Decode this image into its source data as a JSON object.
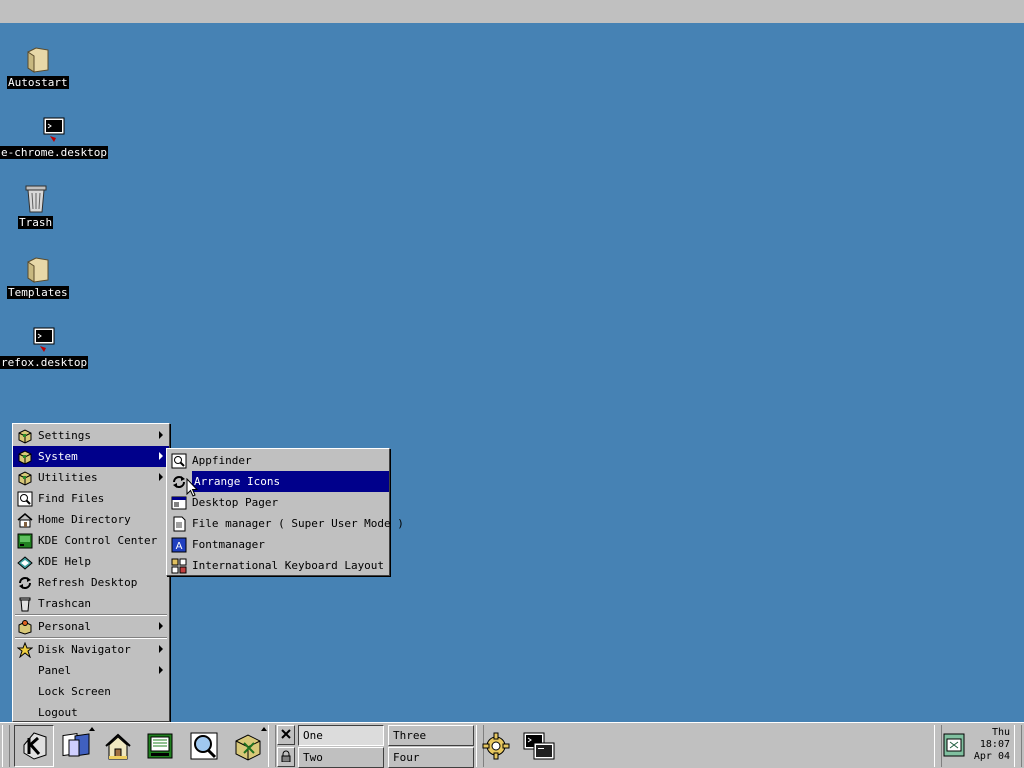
{
  "desktop": {
    "icons": [
      {
        "label": "Autostart",
        "icon": "folder-icon"
      },
      {
        "label": "e-chrome.desktop",
        "icon": "terminal-link-icon"
      },
      {
        "label": "Trash",
        "icon": "trash-icon"
      },
      {
        "label": "Templates",
        "icon": "folder-icon"
      },
      {
        "label": "refox.desktop",
        "icon": "terminal-link-icon"
      }
    ]
  },
  "kmenu": {
    "items": [
      {
        "label": "Settings",
        "icon": "package-icon",
        "submenu": true
      },
      {
        "label": "System",
        "icon": "package-icon",
        "submenu": true,
        "highlighted": true
      },
      {
        "label": "Utilities",
        "icon": "package-icon",
        "submenu": true
      },
      {
        "label": "Find Files",
        "icon": "find-icon"
      },
      {
        "label": "Home Directory",
        "icon": "home-icon"
      },
      {
        "label": "KDE Control Center",
        "icon": "control-center-icon"
      },
      {
        "label": "KDE Help",
        "icon": "help-icon"
      },
      {
        "label": "Refresh Desktop",
        "icon": "refresh-icon"
      },
      {
        "label": "Trashcan",
        "icon": "trash-icon"
      },
      {
        "label": "Personal",
        "icon": "personal-icon",
        "submenu": true
      },
      {
        "label": "Disk Navigator",
        "icon": "disk-navigator-icon",
        "submenu": true
      },
      {
        "label": "Panel",
        "submenu": true
      },
      {
        "label": "Lock Screen"
      },
      {
        "label": "Logout"
      }
    ]
  },
  "system_menu": {
    "items": [
      {
        "label": "Appfinder",
        "icon": "appfinder-icon"
      },
      {
        "label": "Arrange Icons",
        "icon": "arrange-icon",
        "highlighted": true
      },
      {
        "label": "Desktop Pager",
        "icon": "pager-icon"
      },
      {
        "label": "File manager ( Super User Mode )",
        "icon": "file-manager-icon"
      },
      {
        "label": "Fontmanager",
        "icon": "font-icon"
      },
      {
        "label": "International Keyboard Layout",
        "icon": "keyboard-icon"
      }
    ]
  },
  "taskbar": {
    "desktops": [
      "One",
      "Two",
      "Three",
      "Four"
    ],
    "active_desktop": "One",
    "clock": {
      "day": "Thu",
      "time": "18:07",
      "date": "Apr 04"
    }
  },
  "colors": {
    "desktop_bg": "#4682b4",
    "highlight": "#00008b",
    "panel": "#c0c0c0"
  }
}
